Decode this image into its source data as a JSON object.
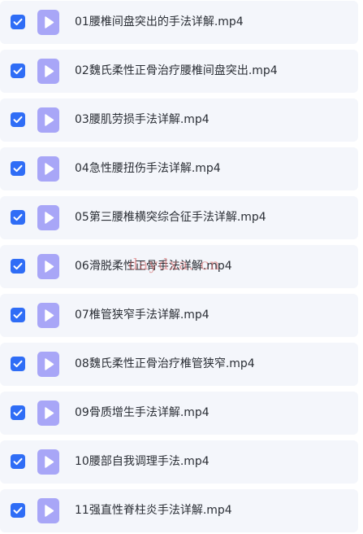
{
  "colors": {
    "row_background": "#f4f6fb",
    "checkbox_checked": "#2f6df6",
    "file_icon": "#a8a6f7",
    "text": "#2b2f36",
    "watermark": "#d66060"
  },
  "files": [
    {
      "name": "01腰椎间盘突出的手法详解.mp4",
      "checked": true,
      "icon": "video-file-icon"
    },
    {
      "name": "02魏氏柔性正骨治疗腰椎间盘突出.mp4",
      "checked": true,
      "icon": "video-file-icon"
    },
    {
      "name": "03腰肌劳损手法详解.mp4",
      "checked": true,
      "icon": "video-file-icon"
    },
    {
      "name": "04急性腰扭伤手法详解.mp4",
      "checked": true,
      "icon": "video-file-icon"
    },
    {
      "name": "05第三腰椎横突综合征手法详解.mp4",
      "checked": true,
      "icon": "video-file-icon"
    },
    {
      "name": "06滑脱柔性正骨手法详解.mp4",
      "checked": true,
      "icon": "video-file-icon"
    },
    {
      "name": "07椎管狭窄手法详解.mp4",
      "checked": true,
      "icon": "video-file-icon"
    },
    {
      "name": "08魏氏柔性正骨治疗椎管狭窄.mp4",
      "checked": true,
      "icon": "video-file-icon"
    },
    {
      "name": "09骨质增生手法详解.mp4",
      "checked": true,
      "icon": "video-file-icon"
    },
    {
      "name": "10腰部自我调理手法.mp4",
      "checked": true,
      "icon": "video-file-icon"
    },
    {
      "name": "11强直性脊柱炎手法详解.mp4",
      "checked": true,
      "icon": "video-file-icon"
    }
  ],
  "watermark": {
    "text": "daydxa. cn"
  }
}
